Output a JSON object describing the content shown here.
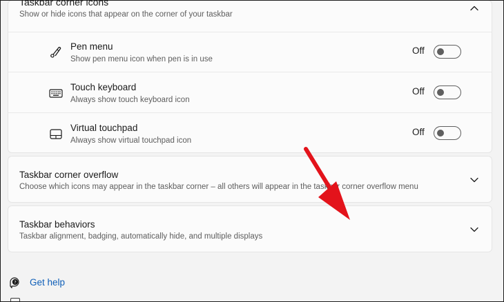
{
  "corner_icons": {
    "title": "Taskbar corner icons",
    "description": "Show or hide icons that appear on the corner of your taskbar",
    "items": [
      {
        "icon": "pen-icon",
        "title": "Pen menu",
        "description": "Show pen menu icon when pen is in use",
        "state": "Off",
        "on": false
      },
      {
        "icon": "keyboard-icon",
        "title": "Touch keyboard",
        "description": "Always show touch keyboard icon",
        "state": "Off",
        "on": false
      },
      {
        "icon": "touchpad-icon",
        "title": "Virtual touchpad",
        "description": "Always show virtual touchpad icon",
        "state": "Off",
        "on": false
      }
    ]
  },
  "corner_overflow": {
    "title": "Taskbar corner overflow",
    "description": "Choose which icons may appear in the taskbar corner – all others will appear in the taskbar corner overflow menu"
  },
  "behaviors": {
    "title": "Taskbar behaviors",
    "description": "Taskbar alignment, badging, automatically hide, and multiple displays"
  },
  "help": {
    "get_help": "Get help"
  },
  "annotation": {
    "arrow_color": "#e3131b"
  },
  "colors": {
    "link": "#0f5fb8",
    "card": "#fbfbfb",
    "background": "#f3f3f3"
  }
}
